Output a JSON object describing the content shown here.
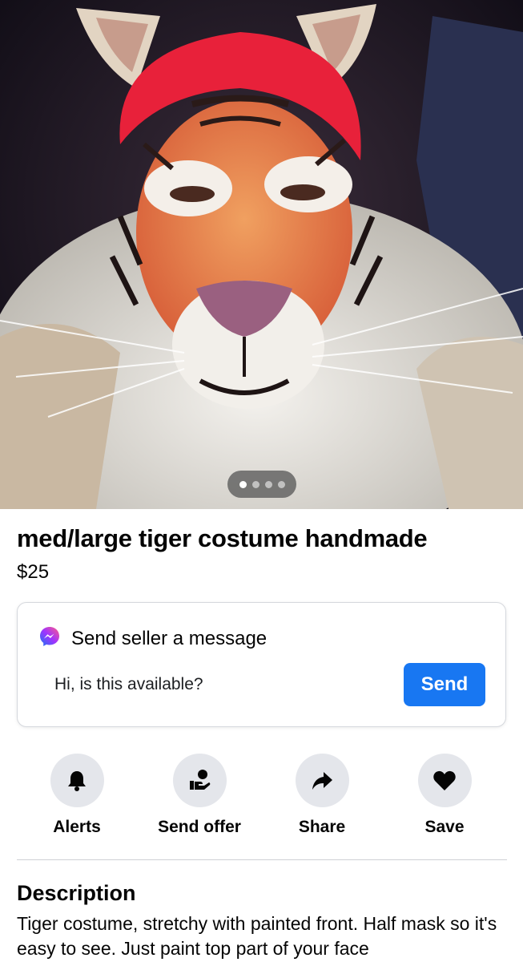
{
  "listing": {
    "title": "med/large tiger costume handmade",
    "price": "$25",
    "photo": {
      "image_count": 4,
      "active_index": 0
    }
  },
  "message": {
    "icon": "messenger-icon",
    "heading": "Send seller a message",
    "input_value": "Hi, is this available?",
    "send_label": "Send",
    "accent": "#1877f2"
  },
  "actions": [
    {
      "icon": "bell-icon",
      "label": "Alerts"
    },
    {
      "icon": "hand-coin-icon",
      "label": "Send offer"
    },
    {
      "icon": "share-arrow-icon",
      "label": "Share"
    },
    {
      "icon": "heart-icon",
      "label": "Save"
    }
  ],
  "description": {
    "heading": "Description",
    "text": "Tiger costume, stretchy with painted front. Half mask so it's easy to see. Just paint top part of your face"
  }
}
